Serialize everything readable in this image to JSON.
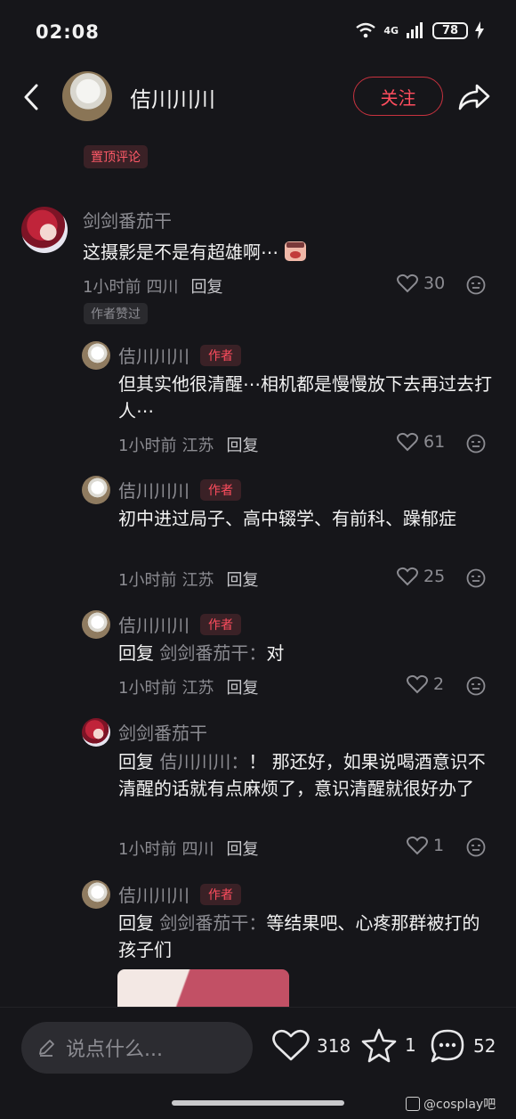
{
  "status_bar": {
    "time": "02:08",
    "network": "4G",
    "battery": "78"
  },
  "header": {
    "user_name": "佶川川川",
    "follow_label": "关注"
  },
  "pinned_label": "置顶评论",
  "comments": [
    {
      "name": "剑剑番茄干",
      "text": "这摄影是不是有超雄啊⋯",
      "time": "1小时前",
      "location": "四川",
      "reply_label": "回复",
      "likes": "30",
      "author_liked_label": "作者赞过"
    },
    {
      "name": "佶川川川",
      "author_tag": "作者",
      "text": "但其实他很清醒⋯相机都是慢慢放下去再过去打人⋯",
      "time": "1小时前",
      "location": "江苏",
      "reply_label": "回复",
      "likes": "61"
    },
    {
      "name": "佶川川川",
      "author_tag": "作者",
      "text": "初中进过局子、高中辍学、有前科、躁郁症",
      "time": "1小时前",
      "location": "江苏",
      "reply_label": "回复",
      "likes": "25"
    },
    {
      "name": "佶川川川",
      "author_tag": "作者",
      "reply_prefix": "回复",
      "reply_target": "剑剑番茄干：",
      "text": "对",
      "time": "1小时前",
      "location": "江苏",
      "reply_label": "回复",
      "likes": "2"
    },
    {
      "name": "剑剑番茄干",
      "reply_prefix": "回复",
      "reply_target": "佶川川川：",
      "text": "！ 那还好，如果说喝酒意识不清醒的话就有点麻烦了，意识清醒就很好办了",
      "time": "1小时前",
      "location": "四川",
      "reply_label": "回复",
      "likes": "1"
    },
    {
      "name": "佶川川川",
      "author_tag": "作者",
      "reply_prefix": "回复",
      "reply_target": "剑剑番茄干：",
      "text": "等结果吧、心疼那群被打的孩子们"
    }
  ],
  "bottom_bar": {
    "input_placeholder": "说点什么...",
    "like_count": "318",
    "star_count": "1",
    "comment_count": "52",
    "watermark": "@cosplay吧"
  },
  "colors": {
    "background": "#16161a",
    "accent": "#ff4d5e",
    "muted": "#8c8c92"
  }
}
